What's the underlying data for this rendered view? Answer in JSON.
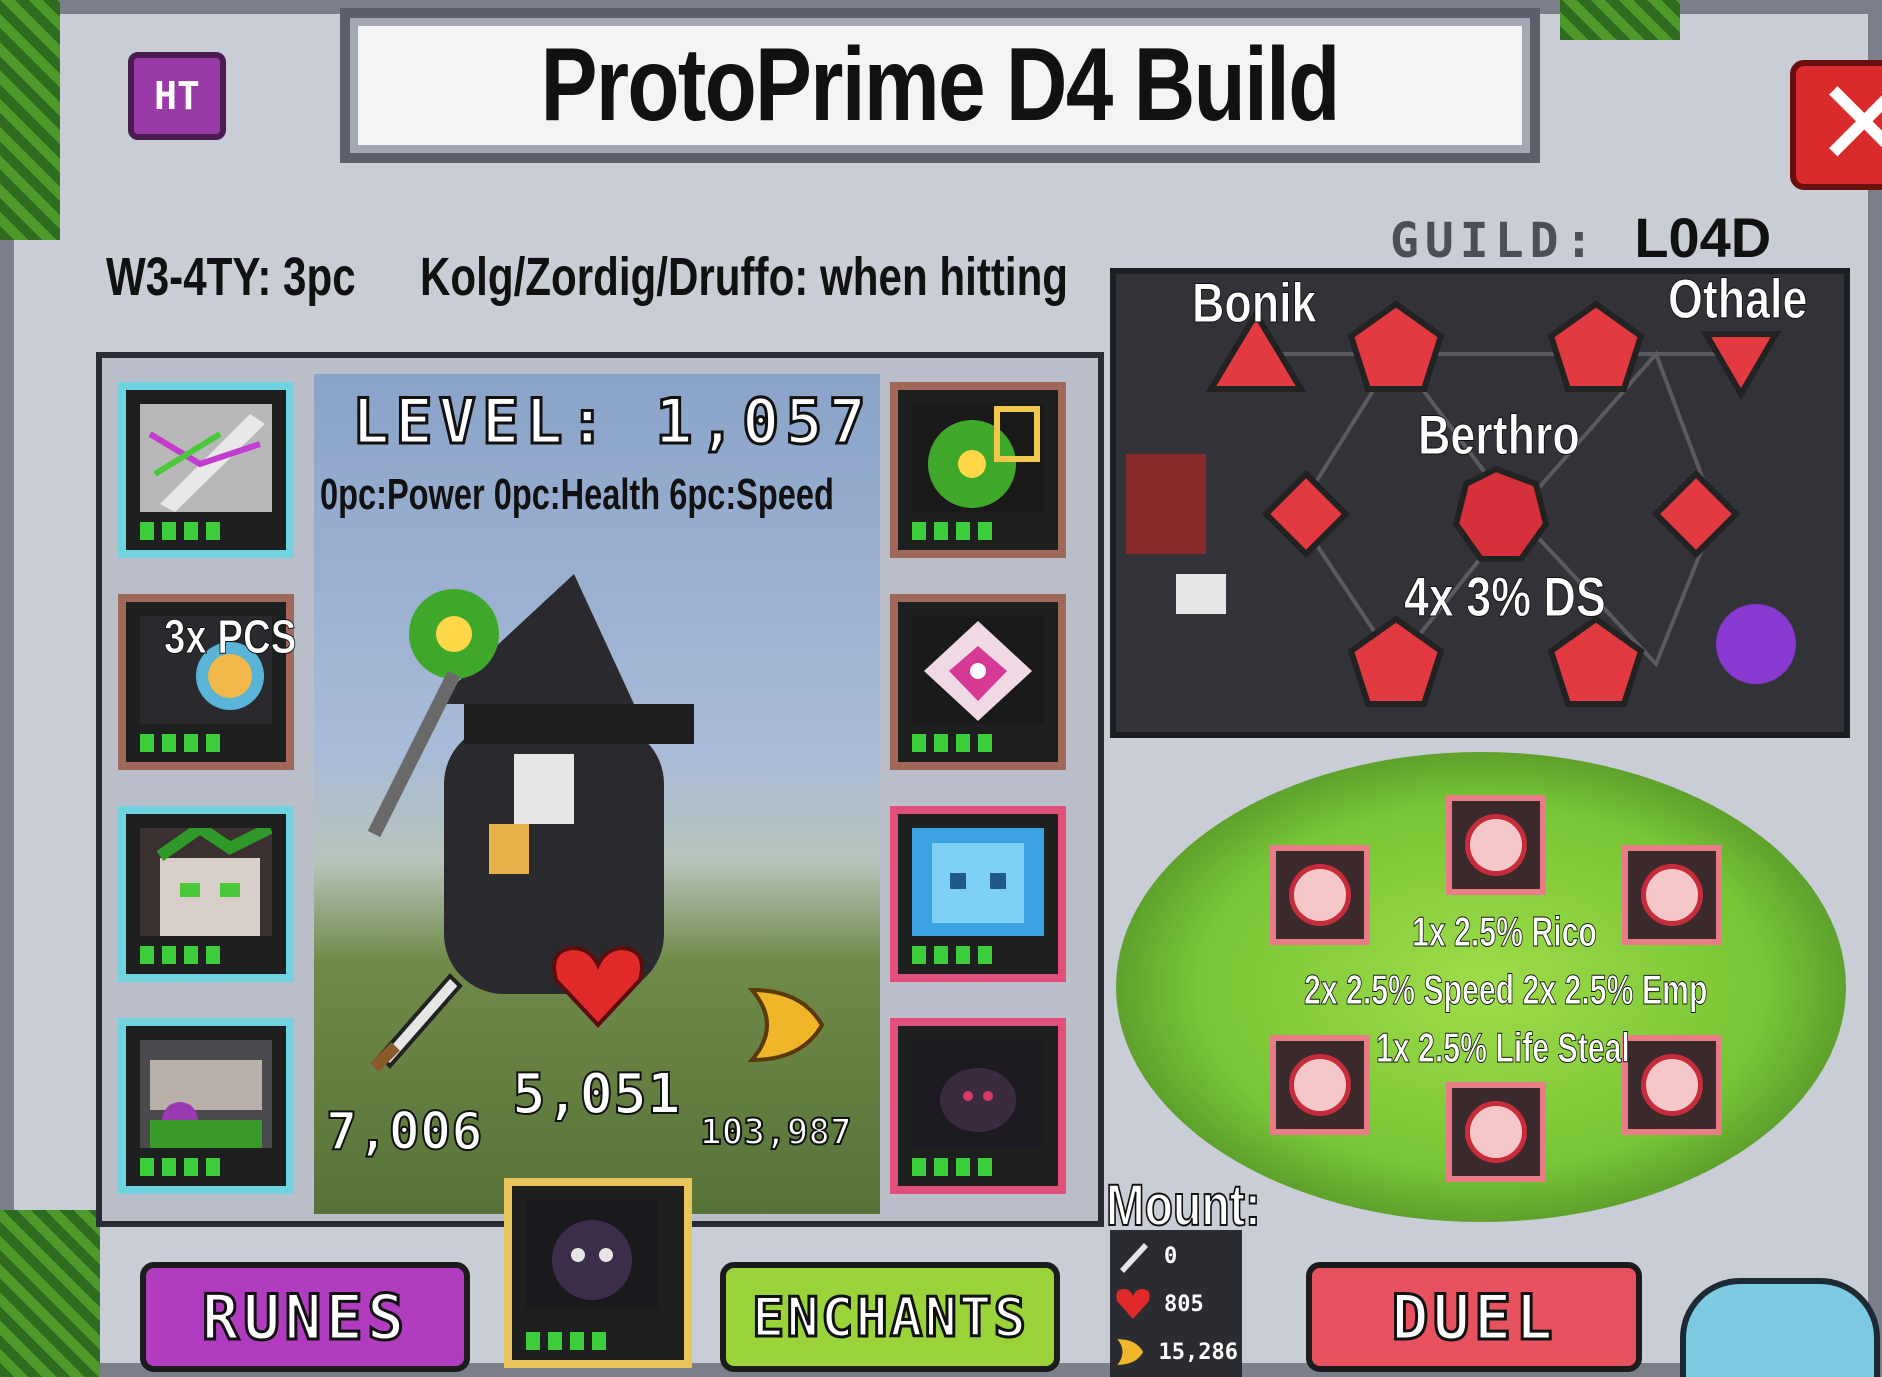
{
  "title": "ProtoPrime D4 Build",
  "ht_badge": "HT",
  "guild": {
    "label": "GUILD",
    "separator": ":",
    "name": "L04D"
  },
  "captions": {
    "left": "W3-4TY: 3pc",
    "right": "Kolg/Zordig/Druffo: when hitting"
  },
  "hero": {
    "level_text": "LEVEL: 1,057",
    "set_bonus": "0pc:Power  0pc:Health  6pc:Speed",
    "pcs_note": "3x PCS",
    "stats": {
      "power": "7,006",
      "health": "5,051",
      "speed": "103,987"
    }
  },
  "equipment": {
    "left_slots": [
      {
        "name": "slot-weapon",
        "border": "cyan",
        "pips": 4
      },
      {
        "name": "slot-helmet",
        "border": "brown",
        "pips": 4
      },
      {
        "name": "slot-armor",
        "border": "cyan",
        "pips": 4
      },
      {
        "name": "slot-boots",
        "border": "cyan",
        "pips": 4
      }
    ],
    "right_slots": [
      {
        "name": "slot-orb",
        "border": "brown",
        "pips": 4
      },
      {
        "name": "slot-ring",
        "border": "brown",
        "pips": 4
      },
      {
        "name": "slot-amulet",
        "border": "pink",
        "pips": 4
      },
      {
        "name": "slot-spider",
        "border": "pink",
        "pips": 4
      }
    ],
    "pet_slot": {
      "border": "gold",
      "pips": 4
    }
  },
  "talents": {
    "names": {
      "left": "Bonik",
      "right": "Othale",
      "center": "Berthro"
    },
    "bonus": "4x 3% DS"
  },
  "cauldron": {
    "bonuses": [
      "1x 2.5% Rico",
      "2x 2.5% Speed  2x 2.5% Emp",
      "1x 2.5% Life Steal"
    ]
  },
  "buttons": {
    "runes": "RUNES",
    "enchants": "ENCHANTS",
    "duel": "DUEL"
  },
  "mount": {
    "label": "Mount:",
    "power": "0",
    "health": "805",
    "speed": "15,286"
  },
  "colors": {
    "runes": "#b23cc0",
    "enchants": "#9ad43a",
    "duel": "#e8525e",
    "title_bg": "#f4f4f6"
  }
}
